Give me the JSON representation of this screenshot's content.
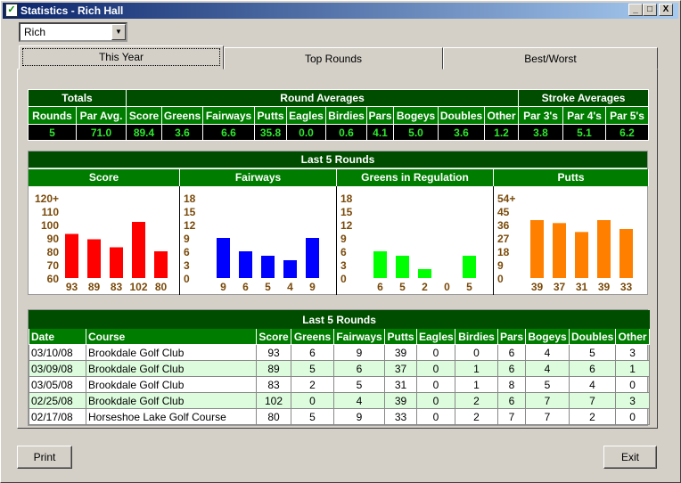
{
  "window": {
    "title": "Statistics - Rich Hall",
    "app_icon": "golf-check-icon",
    "controls": [
      "_",
      "□",
      "X"
    ]
  },
  "player_select": {
    "value": "Rich"
  },
  "tabs": [
    {
      "label": "This Year",
      "active": true
    },
    {
      "label": "Top Rounds"
    },
    {
      "label": "Best/Worst"
    }
  ],
  "summary": {
    "groups": [
      "Totals",
      "Round Averages",
      "Stroke Averages"
    ],
    "headers": [
      "Rounds",
      "Par Avg.",
      "Score",
      "Greens",
      "Fairways",
      "Putts",
      "Eagles",
      "Birdies",
      "Pars",
      "Bogeys",
      "Doubles",
      "Other",
      "Par 3's",
      "Par 4's",
      "Par 5's"
    ],
    "values": [
      "5",
      "71.0",
      "89.4",
      "3.6",
      "6.6",
      "35.8",
      "0.0",
      "0.6",
      "4.1",
      "5.0",
      "3.6",
      "1.2",
      "3.8",
      "5.1",
      "6.2"
    ]
  },
  "chart_data": [
    {
      "type": "bar",
      "title": "Score",
      "group_title": "Last 5 Rounds",
      "color": "#ff0000",
      "ticks": [
        "120+",
        "110",
        "100",
        "90",
        "80",
        "70",
        "60"
      ],
      "ylim": [
        60,
        120
      ],
      "values": [
        93,
        89,
        83,
        102,
        80
      ]
    },
    {
      "type": "bar",
      "title": "Fairways",
      "color": "#0000ff",
      "ticks": [
        "18",
        "15",
        "12",
        "9",
        "6",
        "3",
        "0"
      ],
      "ylim": [
        0,
        18
      ],
      "values": [
        9,
        6,
        5,
        4,
        9
      ]
    },
    {
      "type": "bar",
      "title": "Greens in Regulation",
      "color": "#00ff00",
      "ticks": [
        "18",
        "15",
        "12",
        "9",
        "6",
        "3",
        "0"
      ],
      "ylim": [
        0,
        18
      ],
      "values": [
        6,
        5,
        2,
        0,
        5
      ]
    },
    {
      "type": "bar",
      "title": "Putts",
      "color": "#ff8000",
      "ticks": [
        "54+",
        "45",
        "36",
        "27",
        "18",
        "9",
        "0"
      ],
      "ylim": [
        0,
        54
      ],
      "values": [
        39,
        37,
        31,
        39,
        33
      ]
    }
  ],
  "rounds": {
    "title": "Last 5 Rounds",
    "headers": [
      "Date",
      "Course",
      "Score",
      "Greens",
      "Fairways",
      "Putts",
      "Eagles",
      "Birdies",
      "Pars",
      "Bogeys",
      "Doubles",
      "Other"
    ],
    "rows": [
      [
        "03/10/08",
        "Brookdale Golf Club",
        "93",
        "6",
        "9",
        "39",
        "0",
        "0",
        "6",
        "4",
        "5",
        "3"
      ],
      [
        "03/09/08",
        "Brookdale Golf Club",
        "89",
        "5",
        "6",
        "37",
        "0",
        "1",
        "6",
        "4",
        "6",
        "1"
      ],
      [
        "03/05/08",
        "Brookdale Golf Club",
        "83",
        "2",
        "5",
        "31",
        "0",
        "1",
        "8",
        "5",
        "4",
        "0"
      ],
      [
        "02/25/08",
        "Brookdale Golf Club",
        "102",
        "0",
        "4",
        "39",
        "0",
        "2",
        "6",
        "7",
        "7",
        "3"
      ],
      [
        "02/17/08",
        "Horseshoe Lake Golf Course",
        "80",
        "5",
        "9",
        "33",
        "0",
        "2",
        "7",
        "7",
        "2",
        "0"
      ]
    ]
  },
  "buttons": {
    "print": "Print",
    "exit": "Exit"
  }
}
